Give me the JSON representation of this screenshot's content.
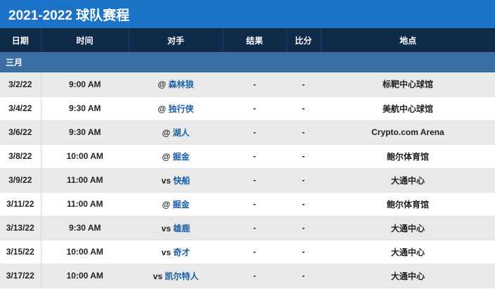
{
  "title": "2021-2022 球队赛程",
  "headers": [
    "日期",
    "时间",
    "对手",
    "结果",
    "比分",
    "地点"
  ],
  "month": "三月",
  "games": [
    {
      "date": "3/2/22",
      "time": "9:00 AM",
      "prefix": "@",
      "team": "森林狼",
      "result": "-",
      "score": "-",
      "venue": "标靶中心球馆"
    },
    {
      "date": "3/4/22",
      "time": "9:30 AM",
      "prefix": "@",
      "team": "独行侠",
      "result": "-",
      "score": "-",
      "venue": "美航中心球馆"
    },
    {
      "date": "3/6/22",
      "time": "9:30 AM",
      "prefix": "@",
      "team": "湖人",
      "result": "-",
      "score": "-",
      "venue": "Crypto.com Arena"
    },
    {
      "date": "3/8/22",
      "time": "10:00 AM",
      "prefix": "@",
      "team": "掘金",
      "result": "-",
      "score": "-",
      "venue": "鲍尔体育馆"
    },
    {
      "date": "3/9/22",
      "time": "11:00 AM",
      "prefix": "vs",
      "team": "快船",
      "result": "-",
      "score": "-",
      "venue": "大通中心"
    },
    {
      "date": "3/11/22",
      "time": "11:00 AM",
      "prefix": "@",
      "team": "掘金",
      "result": "-",
      "score": "-",
      "venue": "鲍尔体育馆"
    },
    {
      "date": "3/13/22",
      "time": "9:30 AM",
      "prefix": "vs",
      "team": "雄鹿",
      "result": "-",
      "score": "-",
      "venue": "大通中心"
    },
    {
      "date": "3/15/22",
      "time": "10:00 AM",
      "prefix": "vs",
      "team": "奇才",
      "result": "-",
      "score": "-",
      "venue": "大通中心"
    },
    {
      "date": "3/17/22",
      "time": "10:00 AM",
      "prefix": "vs",
      "team": "凯尔特人",
      "result": "-",
      "score": "-",
      "venue": "大通中心"
    }
  ]
}
